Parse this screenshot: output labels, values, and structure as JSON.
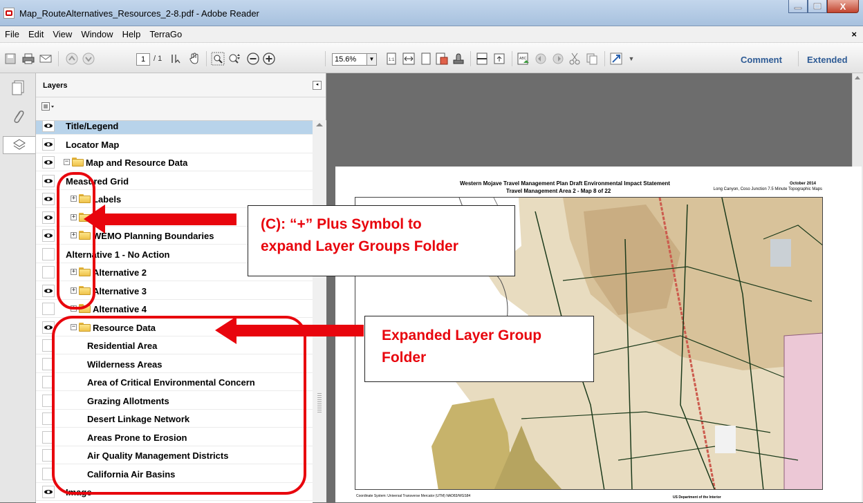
{
  "window": {
    "title": "Map_RouteAlternatives_Resources_2-8.pdf - Adobe Reader",
    "minimize_label": "–",
    "maximize_label": "□",
    "close_label": "X"
  },
  "menu": {
    "items": [
      "File",
      "Edit",
      "View",
      "Window",
      "Help",
      "TerraGo"
    ],
    "close_doc": "×"
  },
  "toolbar": {
    "page_number": "1",
    "page_count": "/ 1",
    "zoom": "15.6%",
    "comment_label": "Comment",
    "extended_label": "Extended",
    "icons": [
      "save-icon",
      "print-icon",
      "email-icon",
      "prev-page-icon",
      "next-page-icon",
      "select-icon",
      "hand-icon",
      "marquee-zoom-icon",
      "dynamic-zoom-icon",
      "zoom-out-icon",
      "zoom-in-icon",
      "actual-size-icon",
      "fit-width-icon",
      "fit-page-icon",
      "read-mode-icon",
      "stamp-icon",
      "split-icon",
      "rotate-icon",
      "pdf-icon",
      "undo-icon",
      "redo-icon",
      "cut-icon",
      "copy-icon",
      "fullscreen-icon"
    ]
  },
  "nav_pane": {
    "buttons": [
      "pages-icon",
      "attachments-icon",
      "layers-icon"
    ]
  },
  "layers_panel": {
    "title": "Layers",
    "collapse": "◂",
    "layers": [
      {
        "label": "Title/Legend",
        "visible": true,
        "indent": 0,
        "folder": false,
        "selected": true
      },
      {
        "label": "Locator Map",
        "visible": true,
        "indent": 0,
        "folder": false
      },
      {
        "label": "Map and Resource Data",
        "visible": true,
        "indent": 0,
        "folder": true,
        "expander": "−"
      },
      {
        "label": "Measured Grid",
        "visible": true,
        "indent": 1,
        "folder": false
      },
      {
        "label": "Labels",
        "visible": true,
        "indent": 1,
        "folder": true,
        "expander": "+"
      },
      {
        "label": "",
        "visible": true,
        "indent": 1,
        "folder": true,
        "expander": "+"
      },
      {
        "label": "WEMO Planning Boundaries",
        "visible": true,
        "indent": 1,
        "folder": true,
        "expander": "+"
      },
      {
        "label": "Alternative 1 - No Action",
        "visible": false,
        "indent": 1,
        "folder": false
      },
      {
        "label": "Alternative 2",
        "visible": false,
        "indent": 1,
        "folder": true,
        "expander": "+"
      },
      {
        "label": "Alternative 3",
        "visible": true,
        "indent": 1,
        "folder": true,
        "expander": "+"
      },
      {
        "label": "Alternative 4",
        "visible": false,
        "indent": 1,
        "folder": true,
        "expander": "+"
      },
      {
        "label": "Resource Data",
        "visible": true,
        "indent": 1,
        "folder": true,
        "expander": "−"
      },
      {
        "label": "Residential Area",
        "visible": false,
        "indent": 2,
        "folder": false
      },
      {
        "label": "Wilderness Areas",
        "visible": false,
        "indent": 2,
        "folder": false
      },
      {
        "label": "Area of Critical Environmental Concern",
        "visible": false,
        "indent": 2,
        "folder": false
      },
      {
        "label": "Grazing Allotments",
        "visible": false,
        "indent": 2,
        "folder": false
      },
      {
        "label": "Desert Linkage Network",
        "visible": false,
        "indent": 2,
        "folder": false
      },
      {
        "label": "Areas Prone to Erosion",
        "visible": false,
        "indent": 2,
        "folder": false
      },
      {
        "label": "Air Quality Management Districts",
        "visible": false,
        "indent": 2,
        "folder": false
      },
      {
        "label": "California Air Basins",
        "visible": false,
        "indent": 2,
        "folder": false
      },
      {
        "label": "Image",
        "visible": true,
        "indent": 1,
        "folder": false
      }
    ]
  },
  "document": {
    "title": "Western Mojave Travel Management Plan Draft Environmental Impact Statement",
    "subtitle": "Travel Management Area 2 - Map 8 of 22",
    "date": "October 2014",
    "quads": "Long Canyon, Coso Junction 7.5 Minute Topographic Maps",
    "coord_note": "Coordinate System: Universal Transverse Mercator (UTM) NAD83/WGS84",
    "agency": "US Department of the Interior"
  },
  "annotations": {
    "callout_c_line1": "(C): “+” Plus Symbol to",
    "callout_c_line2": "expand Layer Groups Folder",
    "callout_expanded_line1": "Expanded Layer Group",
    "callout_expanded_line2": "Folder",
    "color": "#e8050d"
  },
  "colors": {
    "titlebar": "#b4cbe6",
    "selected_row": "#b8d3ea",
    "link": "#2e5b95",
    "annotation_red": "#e8050d"
  }
}
